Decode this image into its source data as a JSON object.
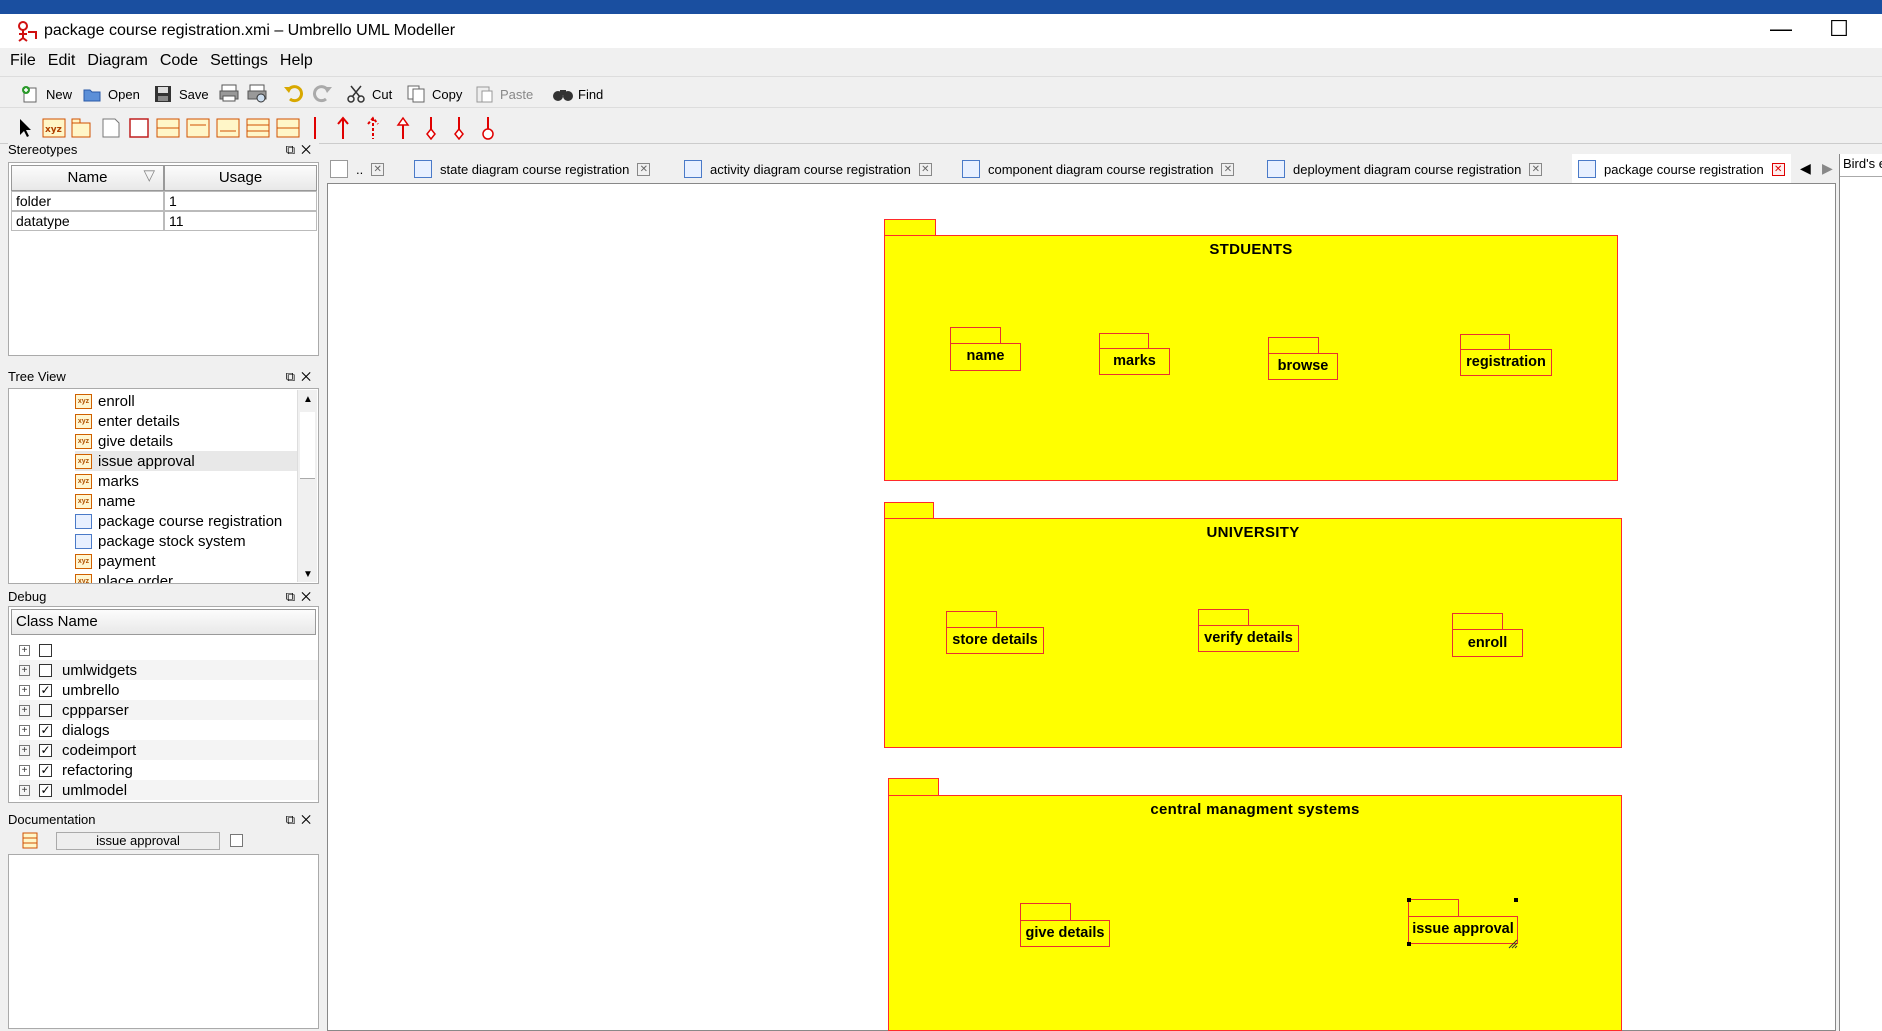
{
  "window": {
    "title": "package course registration.xmi – Umbrello UML Modeller",
    "minimize": "—",
    "maximize": "☐"
  },
  "menu": [
    "File",
    "Edit",
    "Diagram",
    "Code",
    "Settings",
    "Help"
  ],
  "toolbar": {
    "new": "New",
    "open": "Open",
    "save": "Save",
    "cut": "Cut",
    "copy": "Copy",
    "paste": "Paste",
    "find": "Find"
  },
  "stereotypes": {
    "title": "Stereotypes",
    "col_name": "Name",
    "col_usage": "Usage",
    "rows": [
      {
        "name": "folder",
        "usage": "1"
      },
      {
        "name": "datatype",
        "usage": "11"
      }
    ]
  },
  "treeview": {
    "title": "Tree View",
    "items": [
      "enroll",
      "enter details",
      "give details",
      "issue approval",
      "marks",
      "name",
      "package course registration",
      "package stock system",
      "payment",
      "place order"
    ],
    "selected": "issue approval"
  },
  "debug": {
    "title": "Debug",
    "col": "Class Name",
    "rows": [
      {
        "label": "",
        "checked": false
      },
      {
        "label": "umlwidgets",
        "checked": false
      },
      {
        "label": "umbrello",
        "checked": true
      },
      {
        "label": "cppparser",
        "checked": false
      },
      {
        "label": "dialogs",
        "checked": true
      },
      {
        "label": "codeimport",
        "checked": true
      },
      {
        "label": "refactoring",
        "checked": true
      },
      {
        "label": "umlmodel",
        "checked": true
      }
    ]
  },
  "documentation": {
    "title": "Documentation",
    "item": "issue approval"
  },
  "tabs": [
    {
      "label": ".."
    },
    {
      "label": "state diagram course registration"
    },
    {
      "label": "activity diagram course registration"
    },
    {
      "label": "component diagram  course registration"
    },
    {
      "label": "deployment diagram course registration"
    },
    {
      "label": "package course registration",
      "active": true
    }
  ],
  "birds_eye": {
    "title": "Bird's e"
  },
  "diagram": {
    "packages": [
      {
        "title": "STDUENTS",
        "children": [
          "name",
          "marks",
          "browse",
          "registration"
        ]
      },
      {
        "title": "UNIVERSITY",
        "children": [
          "store details",
          "verify details",
          "enroll"
        ]
      },
      {
        "title": "central managment systems",
        "children": [
          "give details",
          "issue approval"
        ]
      }
    ]
  },
  "colors": {
    "package_fill": "#ffff00",
    "package_border": "#ff2a2a",
    "tool_red": "#e00000"
  }
}
